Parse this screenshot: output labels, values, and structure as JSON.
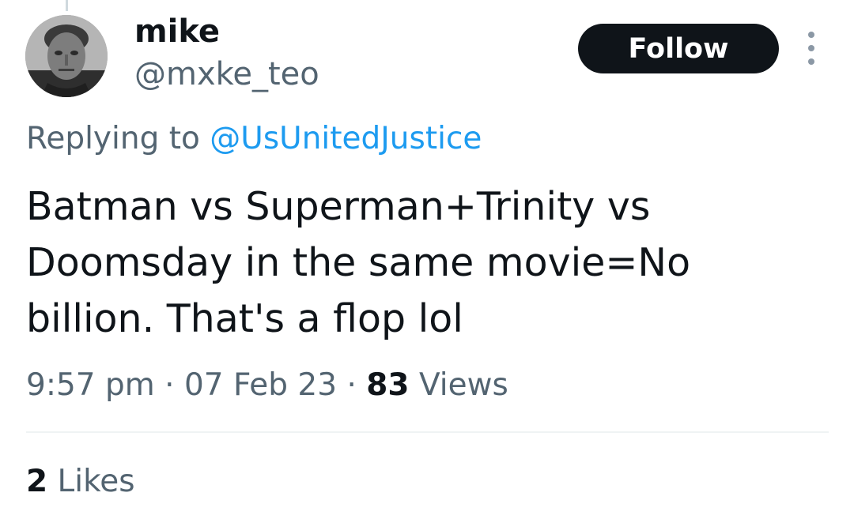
{
  "tweet": {
    "author": {
      "display_name": "mike",
      "handle": "@mxke_teo",
      "avatar_icon": "grayscale-portrait-avatar"
    },
    "follow_label": "Follow",
    "more_icon": "vertical-ellipsis-icon",
    "reply_prefix": "Replying to",
    "reply_mention": "@UsUnitedJustice",
    "text": "Batman vs Superman+Trinity vs\nDoomsday in the same movie=No\nbillion. That's a flop lol",
    "time": "9:57 pm",
    "separator": "·",
    "date": "07 Feb 23",
    "views_count": "83",
    "views_label": "Views",
    "likes_count": "2",
    "likes_label": "Likes"
  },
  "colors": {
    "text_primary": "#0f1419",
    "text_secondary": "#536471",
    "link": "#1d9bf0",
    "follow_button_bg": "#0f1419",
    "divider": "#eff3f4"
  }
}
